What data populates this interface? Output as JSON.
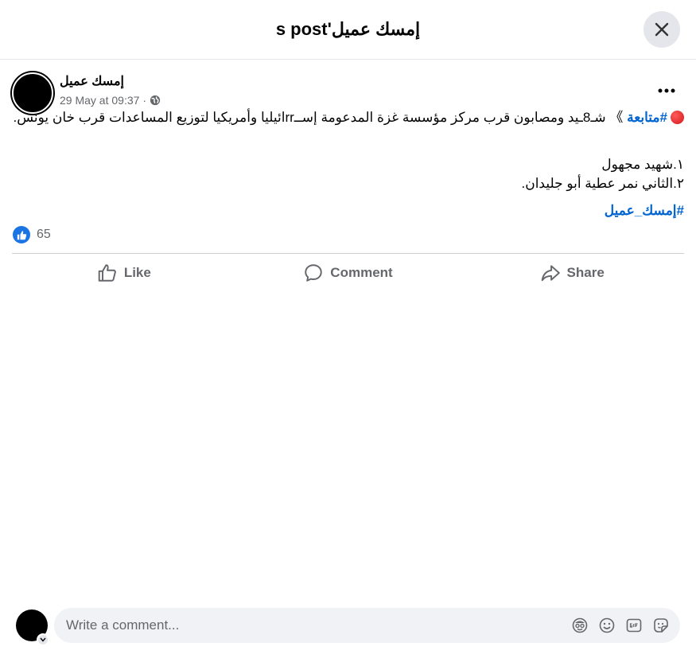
{
  "header": {
    "title": "إمسك عميل's post"
  },
  "post": {
    "author": "إمسك عميل",
    "timestamp": "29 May at 09:37",
    "separator": "·",
    "audience_icon": "globe-icon",
    "hashtag_main": "#متابعة",
    "line1": "》 شـ8ـيد ومصابون قرب مركز مؤسسة غزة المدعومة إســrrائيليا وأمريكيا لتوزيع المساعدات قرب خان يونس.",
    "item1": "١.شهيد مجهول",
    "item2": "٢.الثاني نمر عطية أبو جليدان.",
    "hashtag_footer": "#إمسك_عميل",
    "reaction_count": "65"
  },
  "actions": {
    "like": "Like",
    "comment": "Comment",
    "share": "Share"
  },
  "comment_box": {
    "placeholder": "Write a comment..."
  },
  "colors": {
    "accent": "#1b74e4",
    "link": "#0064d1",
    "muted": "#65676b"
  }
}
